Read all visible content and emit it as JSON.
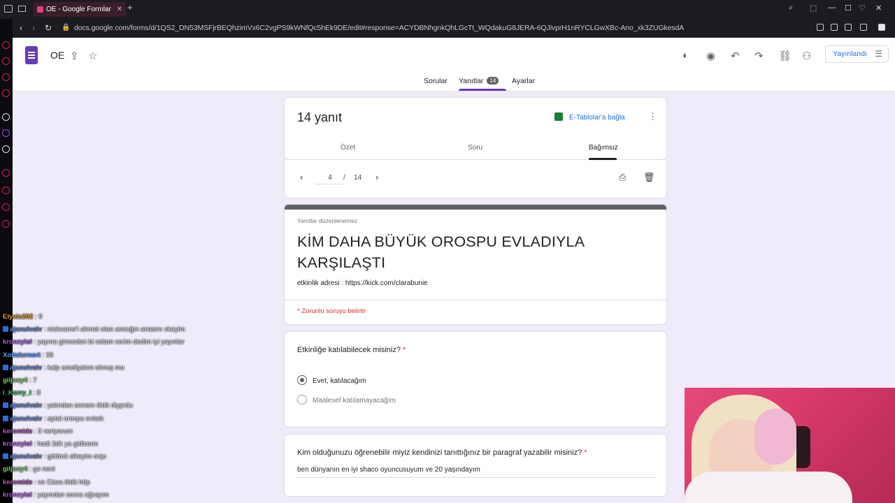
{
  "browser": {
    "tab_title": "OE - Google Formlar",
    "url": "docs.google.com/forms/d/1QS2_DN53MSFjrBEQhzimVx6C2vgPS9kWNfQc5hEk9DE/edit#response=ACYDBNhgnkQhLGcTt_WQdakuG8JERA-6QJivprH1nRYCLGwXBc-Ano_xk3ZUGkesdA"
  },
  "header": {
    "doc_title": "OE",
    "publish_label": "Yayınlandı"
  },
  "tabs": {
    "questions": "Sorular",
    "responses": "Yanıtlar",
    "responses_count": "14",
    "settings": "Ayarlar"
  },
  "responses_card": {
    "title": "14 yanıt",
    "sheets_link": "E-Tablolar'a bağla",
    "subtabs": {
      "summary": "Özet",
      "question": "Soru",
      "individual": "Bağımsız"
    }
  },
  "pager": {
    "current": "4",
    "separator": "/",
    "total": "14"
  },
  "form": {
    "hint": "Yanıtlar düzenlenemez",
    "title": "KİM DAHA BÜYÜK OROSPU EVLADIYLA KARŞILAŞTI",
    "description": "etkinlik adresi : https://kick.com/clarabunie",
    "required_note": "* Zorunlu soruyu belirtir"
  },
  "question1": {
    "title": "Etkinliğe katılabilecek misiniz?",
    "star": "*",
    "options": [
      "Evet, katılacağım",
      "Maalesef katılamayacağım"
    ],
    "selected_index": 0
  },
  "question2": {
    "title": "Kim olduğunuzu öğrenebilir miyiz kendinizi tanıttığınız bir paragraf yazabilir misiniz?",
    "star": "*",
    "answer": "ben dünyanın en iyi shaco oyuncusuyum ve 20 yaşındayım"
  },
  "chat": [
    {
      "user": "Elyala202",
      "color": "#e0a030",
      "text": " : 9"
    },
    {
      "user": "ajanulvalv",
      "color": "#6a8bd6",
      "text": " : nickname'i ahmet olan amcığın anasını skeyim",
      "badge": true
    },
    {
      "user": "kronzylol",
      "color": "#b060e0",
      "text": " : yayına girmeden bi selam verim dedim iyi yayınlar"
    },
    {
      "user": "Xoltalurnort",
      "color": "#5aa0ff",
      "text": " : 36"
    },
    {
      "user": "ajanulvalv",
      "color": "#6a8bd6",
      "text": " : kalp ameliyatım olmuş mu",
      "badge": true
    },
    {
      "user": "giljoey4",
      "color": "#7ad07a",
      "text": " : 7"
    },
    {
      "user": "I_Kerry_I",
      "color": "#30c060",
      "text": " : 8"
    },
    {
      "user": "ajanulvalv",
      "color": "#6a8bd6",
      "text": " : yalından annem öldü diyprdu",
      "badge": true
    },
    {
      "user": "ajanulvalv",
      "color": "#6a8bd6",
      "text": " : aptal orospu evladı",
      "badge": true
    },
    {
      "user": "keromide",
      "color": "#c050c0",
      "text": " : 3 veriyorum"
    },
    {
      "user": "kronzylol",
      "color": "#b060e0",
      "text": " : hadi 2dk ya gidiceım"
    },
    {
      "user": "ajanulvalv",
      "color": "#6a8bd6",
      "text": " : götünü sikeyim onju",
      "badge": true
    },
    {
      "user": "giljoey4",
      "color": "#7ad07a",
      "text": " : go next"
    },
    {
      "user": "keromide",
      "color": "#c050c0",
      "text": " : ve Clara öldü http"
    },
    {
      "user": "kronzylol",
      "color": "#b060e0",
      "text": " : yayından sonra oğrayım"
    }
  ]
}
